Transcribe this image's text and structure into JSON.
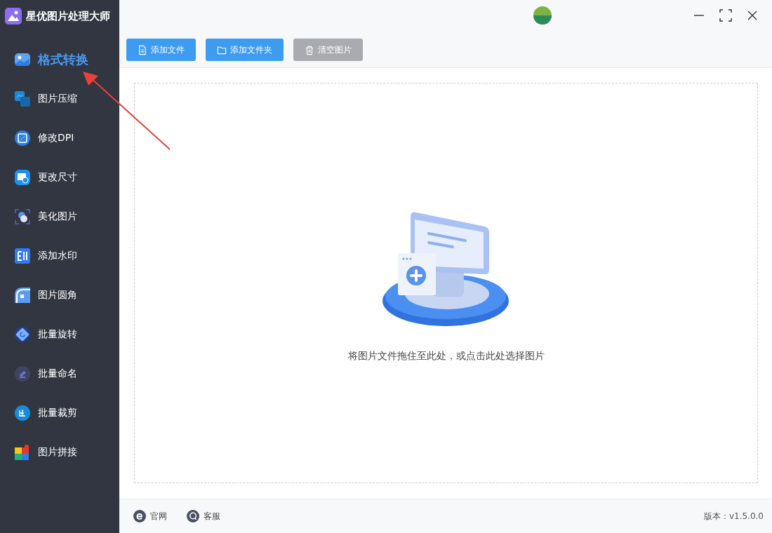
{
  "app": {
    "title": "星优图片处理大师"
  },
  "sidebar": {
    "items": [
      {
        "label": "格式转换",
        "selected": true
      },
      {
        "label": "图片压缩",
        "selected": false
      },
      {
        "label": "修改DPI",
        "selected": false
      },
      {
        "label": "更改尺寸",
        "selected": false
      },
      {
        "label": "美化图片",
        "selected": false
      },
      {
        "label": "添加水印",
        "selected": false
      },
      {
        "label": "图片圆角",
        "selected": false
      },
      {
        "label": "批量旋转",
        "selected": false
      },
      {
        "label": "批量命名",
        "selected": false
      },
      {
        "label": "批量裁剪",
        "selected": false
      },
      {
        "label": "图片拼接",
        "selected": false
      }
    ]
  },
  "toolbar": {
    "buttons": [
      {
        "label": "添加文件",
        "disabled": false
      },
      {
        "label": "添加文件夹",
        "disabled": false
      },
      {
        "label": "清空图片",
        "disabled": true
      }
    ]
  },
  "drop_zone": {
    "hint": "将图片文件拖住至此处，或点击此处选择图片"
  },
  "footer": {
    "links": [
      "官网",
      "客服"
    ],
    "version": "版本：v1.5.0.0"
  }
}
